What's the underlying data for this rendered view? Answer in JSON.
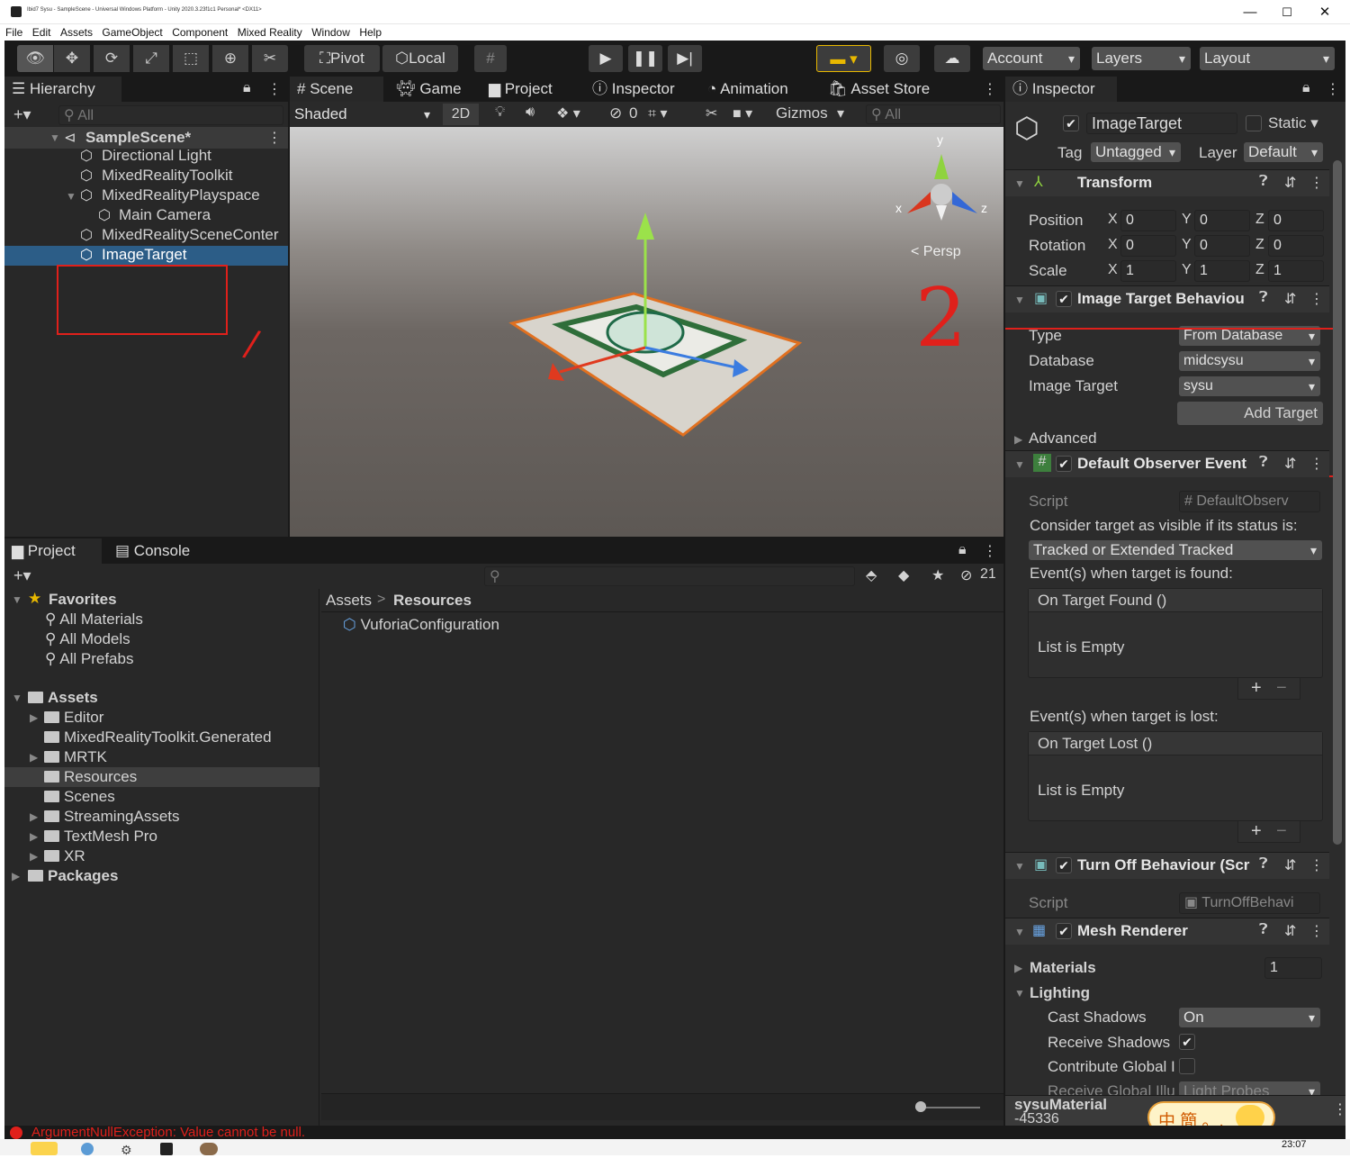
{
  "window": {
    "title": "Ibid7 Sysu - SampleScene - Universal Windows Platform - Unity 2020.3.23f1c1 Personal* <DX11>",
    "min": "—",
    "max": "☐",
    "close": "✕"
  },
  "menu": [
    "File",
    "Edit",
    "Assets",
    "GameObject",
    "Component",
    "Mixed Reality",
    "Window",
    "Help"
  ],
  "toolbar": {
    "pivot": "Pivot",
    "local": "Local",
    "account": "Account",
    "layers": "Layers",
    "layout": "Layout"
  },
  "hierarchy": {
    "tab": "Hierarchy",
    "search_placeholder": "All",
    "scene": "SampleScene*",
    "items": [
      "Directional Light",
      "MixedRealityToolkit",
      "MixedRealityPlayspace",
      "Main Camera",
      "MixedRealitySceneConter",
      "ImageTarget"
    ]
  },
  "scene_tabs": [
    "Scene",
    "Game",
    "Project",
    "Inspector",
    "Animation",
    "Asset Store"
  ],
  "scene_toolbar": {
    "shading": "Shaded",
    "mode2d": "2D",
    "hidden_count": "0",
    "gizmos": "Gizmos",
    "search": "All"
  },
  "gizmo": {
    "x": "x",
    "y": "y",
    "z": "z",
    "persp": "< Persp"
  },
  "annotations": [
    "/",
    "2"
  ],
  "project": {
    "tabs": [
      "Project",
      "Console"
    ],
    "hidden_count": "21",
    "favorites": {
      "label": "Favorites",
      "items": [
        "All Materials",
        "All Models",
        "All Prefabs"
      ]
    },
    "assets": {
      "label": "Assets",
      "items": [
        "Editor",
        "MixedRealityToolkit.Generated",
        "MRTK",
        "Resources",
        "Scenes",
        "StreamingAssets",
        "TextMesh Pro",
        "XR"
      ]
    },
    "packages": "Packages",
    "breadcrumb": [
      "Assets",
      "Resources"
    ],
    "files": [
      "VuforiaConfiguration"
    ]
  },
  "error": "ArgumentNullException: Value cannot be null.",
  "inspector": {
    "tab": "Inspector",
    "name": "ImageTarget",
    "static": "Static",
    "tag_label": "Tag",
    "tag": "Untagged",
    "layer_label": "Layer",
    "layer": "Default",
    "transform": {
      "title": "Transform",
      "rows": [
        {
          "label": "Position",
          "x": "0",
          "y": "0",
          "z": "0"
        },
        {
          "label": "Rotation",
          "x": "0",
          "y": "0",
          "z": "0"
        },
        {
          "label": "Scale",
          "x": "1",
          "y": "1",
          "z": "1"
        }
      ]
    },
    "itb": {
      "title": "Image Target Behaviou",
      "type_label": "Type",
      "type": "From Database",
      "db_label": "Database",
      "db": "midcsysu",
      "it_label": "Image Target",
      "it": "sysu",
      "add": "Add Target",
      "advanced": "Advanced"
    },
    "doe": {
      "title": "Default Observer Event",
      "script_label": "Script",
      "script": "DefaultObserv",
      "consider": "Consider target as visible if its status is:",
      "status": "Tracked or Extended Tracked",
      "found_label": "Event(s) when target is found:",
      "found_event": "On Target Found ()",
      "empty": "List is Empty",
      "lost_label": "Event(s) when target is lost:",
      "lost_event": "On Target Lost ()",
      "plus": "+",
      "minus": "−"
    },
    "tob": {
      "title": "Turn Off Behaviour (Scr",
      "script_label": "Script",
      "script": "TurnOffBehavi"
    },
    "mr": {
      "title": "Mesh Renderer",
      "materials": "Materials",
      "materials_count": "1",
      "lighting": "Lighting",
      "cast_label": "Cast Shadows",
      "cast": "On",
      "receive_label": "Receive Shadows",
      "contrib_label": "Contribute Global I",
      "rgi_label": "Receive Global Illu",
      "rgi": "Light Probes"
    },
    "material": {
      "name": "sysuMaterial",
      "id": "-45336"
    }
  },
  "ime": {
    "label": "中 簡 。,"
  },
  "taskbar": {
    "time": "23:07"
  }
}
